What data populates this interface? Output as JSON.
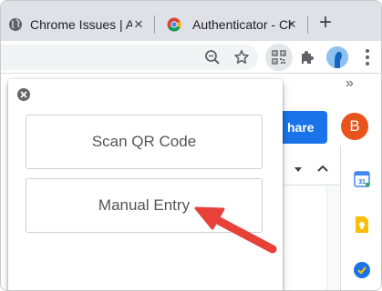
{
  "browser": {
    "tabs": [
      {
        "title": "Chrome Issues | Au",
        "favicon": "globe-icon"
      },
      {
        "title": "Authenticator - Ch",
        "favicon": "chrome-icon"
      }
    ],
    "new_tab_symbol": "+",
    "tab_close_symbol": "×",
    "toolbar_icons": [
      "zoom-out-icon",
      "star-icon",
      "qr-extension-icon",
      "puzzle-extension-icon",
      "profile-avatar",
      "menu-dots-icon"
    ],
    "bookmarks_overflow": "»"
  },
  "background_page": {
    "share_label": "hare",
    "avatar_letter": "B",
    "avatar_color": "#e8531e",
    "share_color": "#1a73e8",
    "side_apps": [
      "calendar-icon",
      "keep-icon",
      "tasks-icon"
    ],
    "calendar_day": "31"
  },
  "popup": {
    "scan_label": "Scan QR Code",
    "manual_label": "Manual Entry"
  },
  "annotation": {
    "arrow_color": "#e8413a",
    "points_to": "Manual Entry"
  }
}
